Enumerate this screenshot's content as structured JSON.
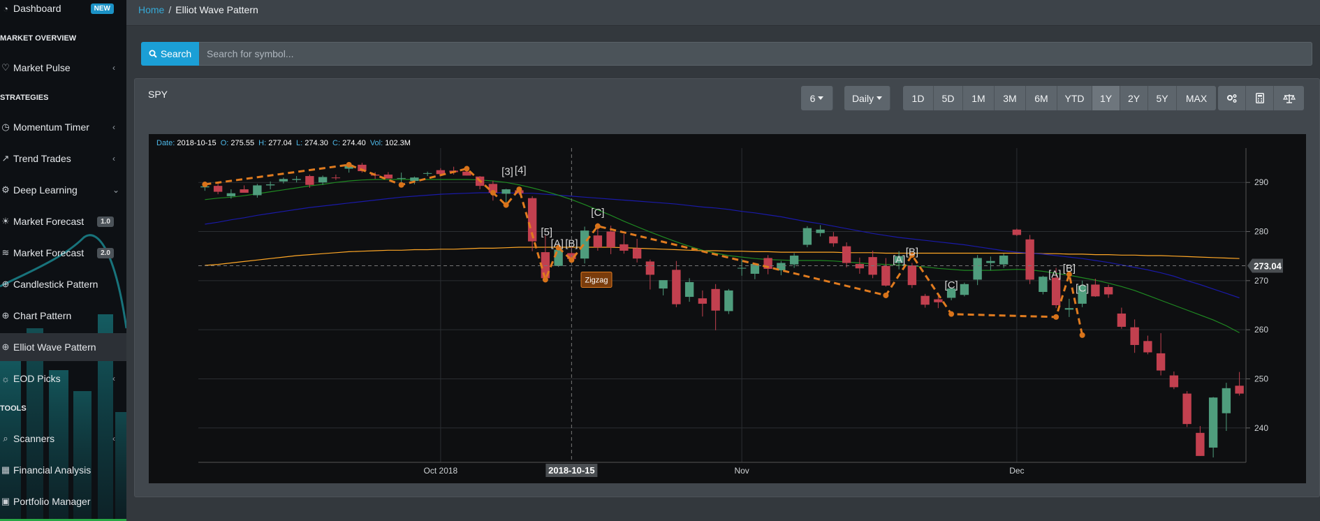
{
  "sidebar": {
    "items": [
      {
        "label": "Dashboard",
        "icon": "dashboard-icon",
        "badge": "NEW",
        "badge_type": "new"
      },
      {
        "section": "MARKET OVERVIEW"
      },
      {
        "label": "Market Pulse",
        "icon": "heart-icon",
        "chevron": "‹"
      },
      {
        "section": "STRATEGIES"
      },
      {
        "label": "Momentum Timer",
        "icon": "timer-icon",
        "chevron": "‹"
      },
      {
        "label": "Trend Trades",
        "icon": "line-chart-icon",
        "chevron": "‹"
      },
      {
        "label": "Deep Learning",
        "icon": "brain-icon",
        "chevron": "⌄"
      },
      {
        "label": "Market Forecast",
        "icon": "bulb-icon",
        "badge": "1.0",
        "badge_type": "ver"
      },
      {
        "label": "Market Forecast",
        "icon": "signal-icon",
        "badge": "2.0",
        "badge_type": "ver"
      },
      {
        "label": "Candlestick Pattern",
        "icon": "search-plus-icon"
      },
      {
        "label": "Chart Pattern",
        "icon": "search-plus-icon"
      },
      {
        "label": "Elliot Wave Pattern",
        "icon": "search-plus-icon",
        "active": true
      },
      {
        "label": "EOD Picks",
        "icon": "lightbulb-icon",
        "chevron": "‹"
      },
      {
        "section": "TOOLS"
      },
      {
        "label": "Scanners",
        "icon": "search-icon",
        "chevron": "‹"
      },
      {
        "label": "Financial Analysis",
        "icon": "grid-icon"
      },
      {
        "label": "Portfolio Manager",
        "icon": "briefcase-icon"
      }
    ]
  },
  "breadcrumb": {
    "home": "Home",
    "separator": "/",
    "current": "Elliot Wave Pattern"
  },
  "search": {
    "button_label": "Search",
    "placeholder": "Search for symbol..."
  },
  "panel": {
    "symbol": "SPY",
    "count_select": "6",
    "interval_select": "Daily",
    "ranges": [
      "1D",
      "5D",
      "1M",
      "3M",
      "6M",
      "YTD",
      "1Y",
      "2Y",
      "5Y",
      "MAX"
    ],
    "active_range": "1Y",
    "tool_icons": [
      "settings-icon",
      "calculator-icon",
      "balance-scale-icon"
    ]
  },
  "chart_data": {
    "type": "candlestick",
    "symbol": "SPY",
    "info": {
      "date_label": "Date:",
      "date": "2018-10-15",
      "o_label": "O:",
      "open": "275.55",
      "h_label": "H:",
      "high": "277.04",
      "l_label": "L:",
      "low": "274.30",
      "c_label": "C:",
      "close": "274.40",
      "vol_label": "Vol:",
      "volume": "102.3M"
    },
    "y_ticks": [
      290,
      280,
      270,
      260,
      250,
      240
    ],
    "y_range": [
      233,
      297
    ],
    "x_labels": [
      {
        "label": "Oct 2018",
        "i": 18
      },
      {
        "label": "Nov",
        "i": 41
      },
      {
        "label": "Dec",
        "i": 62
      }
    ],
    "crosshair": {
      "i": 28,
      "date_label": "2018-10-15",
      "price_label": "273.04",
      "price": 273.04
    },
    "candles": [
      {
        "o": 289.0,
        "h": 289.7,
        "l": 288.3,
        "c": 289.2
      },
      {
        "o": 289.3,
        "h": 289.8,
        "l": 287.6,
        "c": 288.1
      },
      {
        "o": 287.2,
        "h": 288.6,
        "l": 286.7,
        "c": 287.8
      },
      {
        "o": 288.6,
        "h": 289.4,
        "l": 287.9,
        "c": 287.9
      },
      {
        "o": 287.4,
        "h": 289.7,
        "l": 286.9,
        "c": 289.4
      },
      {
        "o": 289.4,
        "h": 290.2,
        "l": 288.6,
        "c": 289.6
      },
      {
        "o": 290.2,
        "h": 291.0,
        "l": 289.8,
        "c": 290.7
      },
      {
        "o": 290.5,
        "h": 291.3,
        "l": 290.0,
        "c": 290.7
      },
      {
        "o": 291.3,
        "h": 291.6,
        "l": 288.9,
        "c": 289.5
      },
      {
        "o": 290.0,
        "h": 291.4,
        "l": 289.5,
        "c": 291.1
      },
      {
        "o": 291.0,
        "h": 291.6,
        "l": 290.5,
        "c": 290.9
      },
      {
        "o": 292.8,
        "h": 293.8,
        "l": 292.0,
        "c": 293.6
      },
      {
        "o": 293.6,
        "h": 294.0,
        "l": 292.0,
        "c": 292.3
      },
      {
        "o": 291.6,
        "h": 292.1,
        "l": 290.7,
        "c": 291.4
      },
      {
        "o": 291.6,
        "h": 292.1,
        "l": 290.8,
        "c": 290.8
      },
      {
        "o": 290.8,
        "h": 292.0,
        "l": 290.0,
        "c": 290.9
      },
      {
        "o": 290.3,
        "h": 291.2,
        "l": 289.6,
        "c": 291.0
      },
      {
        "o": 291.8,
        "h": 292.2,
        "l": 291.3,
        "c": 291.9
      },
      {
        "o": 292.5,
        "h": 292.9,
        "l": 291.4,
        "c": 291.7
      },
      {
        "o": 292.4,
        "h": 293.2,
        "l": 291.6,
        "c": 292.1
      },
      {
        "o": 292.2,
        "h": 292.6,
        "l": 291.4,
        "c": 291.4
      },
      {
        "o": 291.2,
        "h": 291.3,
        "l": 288.6,
        "c": 289.3
      },
      {
        "o": 289.7,
        "h": 290.3,
        "l": 286.3,
        "c": 287.9
      },
      {
        "o": 287.7,
        "h": 288.7,
        "l": 285.4,
        "c": 288.6
      },
      {
        "o": 288.4,
        "h": 288.9,
        "l": 287.5,
        "c": 287.8
      },
      {
        "o": 286.8,
        "h": 287.2,
        "l": 276.0,
        "c": 278.0
      },
      {
        "o": 275.8,
        "h": 279.2,
        "l": 269.9,
        "c": 270.5
      },
      {
        "o": 273.0,
        "h": 276.5,
        "l": 272.8,
        "c": 276.3
      },
      {
        "o": 275.6,
        "h": 277.0,
        "l": 274.3,
        "c": 274.4
      },
      {
        "o": 274.5,
        "h": 281.0,
        "l": 273.5,
        "c": 280.2
      },
      {
        "o": 279.2,
        "h": 281.7,
        "l": 276.1,
        "c": 276.8
      },
      {
        "o": 280.0,
        "h": 281.2,
        "l": 275.4,
        "c": 276.8
      },
      {
        "o": 277.4,
        "h": 279.5,
        "l": 275.5,
        "c": 276.1
      },
      {
        "o": 276.6,
        "h": 278.5,
        "l": 273.7,
        "c": 274.5
      },
      {
        "o": 273.9,
        "h": 274.3,
        "l": 268.2,
        "c": 271.2
      },
      {
        "o": 268.4,
        "h": 270.0,
        "l": 267.0,
        "c": 270.1
      },
      {
        "o": 272.2,
        "h": 274.0,
        "l": 264.6,
        "c": 265.2
      },
      {
        "o": 266.7,
        "h": 270.5,
        "l": 265.7,
        "c": 269.7
      },
      {
        "o": 266.4,
        "h": 268.0,
        "l": 262.7,
        "c": 265.3
      },
      {
        "o": 268.3,
        "h": 269.3,
        "l": 259.9,
        "c": 263.9
      },
      {
        "o": 263.8,
        "h": 268.3,
        "l": 263.2,
        "c": 268.0
      },
      {
        "o": 272.6,
        "h": 274.4,
        "l": 271.0,
        "c": 272.6
      },
      {
        "o": 271.4,
        "h": 273.6,
        "l": 270.3,
        "c": 273.4
      },
      {
        "o": 274.6,
        "h": 275.2,
        "l": 271.3,
        "c": 272.4
      },
      {
        "o": 272.1,
        "h": 274.0,
        "l": 271.1,
        "c": 273.6
      },
      {
        "o": 273.3,
        "h": 275.6,
        "l": 272.6,
        "c": 275.1
      },
      {
        "o": 277.3,
        "h": 281.1,
        "l": 276.8,
        "c": 280.7
      },
      {
        "o": 279.7,
        "h": 281.3,
        "l": 279.0,
        "c": 280.4
      },
      {
        "o": 279.0,
        "h": 279.9,
        "l": 276.9,
        "c": 277.6
      },
      {
        "o": 277.0,
        "h": 277.8,
        "l": 272.7,
        "c": 273.6
      },
      {
        "o": 273.4,
        "h": 274.7,
        "l": 271.4,
        "c": 272.5
      },
      {
        "o": 274.8,
        "h": 276.1,
        "l": 270.5,
        "c": 271.2
      },
      {
        "o": 273.0,
        "h": 274.6,
        "l": 268.8,
        "c": 269.0
      },
      {
        "o": 273.6,
        "h": 276.0,
        "l": 272.3,
        "c": 275.0
      },
      {
        "o": 273.1,
        "h": 273.6,
        "l": 268.5,
        "c": 269.1
      },
      {
        "o": 266.9,
        "h": 267.3,
        "l": 264.5,
        "c": 265.1
      },
      {
        "o": 266.2,
        "h": 267.2,
        "l": 264.4,
        "c": 265.6
      },
      {
        "o": 266.5,
        "h": 268.6,
        "l": 266.0,
        "c": 268.4
      },
      {
        "o": 267.1,
        "h": 269.6,
        "l": 266.8,
        "c": 269.3
      },
      {
        "o": 270.2,
        "h": 275.2,
        "l": 269.1,
        "c": 274.6
      },
      {
        "o": 273.6,
        "h": 274.9,
        "l": 272.1,
        "c": 274.0
      },
      {
        "o": 273.3,
        "h": 275.5,
        "l": 272.6,
        "c": 275.1
      },
      {
        "o": 280.4,
        "h": 280.6,
        "l": 279.1,
        "c": 279.3
      },
      {
        "o": 278.4,
        "h": 279.3,
        "l": 269.3,
        "c": 270.2
      },
      {
        "o": 267.7,
        "h": 271.0,
        "l": 267.2,
        "c": 270.8
      },
      {
        "o": 270.6,
        "h": 272.6,
        "l": 264.4,
        "c": 265.0
      },
      {
        "o": 264.1,
        "h": 266.3,
        "l": 262.6,
        "c": 264.4
      },
      {
        "o": 265.3,
        "h": 270.0,
        "l": 264.6,
        "c": 269.0
      },
      {
        "o": 269.2,
        "h": 270.4,
        "l": 266.7,
        "c": 266.8
      },
      {
        "o": 268.7,
        "h": 269.2,
        "l": 266.5,
        "c": 267.2
      },
      {
        "o": 263.3,
        "h": 264.5,
        "l": 260.2,
        "c": 260.6
      },
      {
        "o": 260.5,
        "h": 262.1,
        "l": 255.3,
        "c": 256.9
      },
      {
        "o": 257.7,
        "h": 258.8,
        "l": 255.0,
        "c": 255.4
      },
      {
        "o": 255.2,
        "h": 259.3,
        "l": 250.7,
        "c": 251.7
      },
      {
        "o": 250.7,
        "h": 251.5,
        "l": 247.9,
        "c": 248.3
      },
      {
        "o": 247.0,
        "h": 247.5,
        "l": 240.2,
        "c": 240.8
      },
      {
        "o": 239.0,
        "h": 240.4,
        "l": 234.3,
        "c": 234.3
      },
      {
        "o": 236.0,
        "h": 246.3,
        "l": 234.0,
        "c": 246.2
      },
      {
        "o": 243.0,
        "h": 249.2,
        "l": 239.4,
        "c": 248.1
      },
      {
        "o": 248.6,
        "h": 251.4,
        "l": 246.6,
        "c": 247.0
      }
    ],
    "moving_averages": [
      {
        "color": "#ffa726",
        "values": [
          273.1,
          273.3,
          273.6,
          273.9,
          274.2,
          274.5,
          274.8,
          275.1,
          275.3,
          275.5,
          275.7,
          275.9,
          276.0,
          276.1,
          276.2,
          276.2,
          276.3,
          276.3,
          276.4,
          276.4,
          276.5,
          276.6,
          276.6,
          276.7,
          276.8,
          276.8,
          276.8,
          276.8,
          276.8,
          276.8,
          276.8,
          276.8,
          276.7,
          276.6,
          276.5,
          276.4,
          276.3,
          276.2,
          276.1,
          276.1,
          276.0,
          276.0,
          275.9,
          275.9,
          275.8,
          275.8,
          275.8,
          275.8,
          275.8,
          275.7,
          275.7,
          275.7,
          275.6,
          275.6,
          275.6,
          275.6,
          275.6,
          275.6,
          275.6,
          275.6,
          275.6,
          275.6,
          275.6,
          275.6,
          275.5,
          275.5,
          275.4,
          275.4,
          275.3,
          275.3,
          275.2,
          275.2,
          275.1,
          275.1,
          275.0,
          274.9,
          274.8,
          274.7,
          274.6,
          274.5
        ]
      },
      {
        "color": "#1a1aa8",
        "values": [
          281.5,
          281.9,
          282.4,
          282.8,
          283.3,
          283.7,
          284.1,
          284.5,
          284.9,
          285.2,
          285.5,
          285.8,
          286.1,
          286.4,
          286.7,
          287.0,
          287.2,
          287.4,
          287.6,
          287.7,
          287.8,
          287.9,
          287.9,
          287.9,
          287.8,
          287.8,
          287.6,
          287.4,
          287.2,
          287.0,
          286.8,
          286.6,
          286.4,
          286.2,
          286.0,
          285.8,
          285.6,
          285.3,
          285.0,
          284.8,
          284.5,
          284.1,
          283.8,
          283.4,
          283.0,
          282.5,
          282.0,
          281.6,
          281.1,
          280.6,
          280.1,
          279.6,
          279.2,
          278.8,
          278.5,
          278.2,
          277.9,
          277.6,
          277.3,
          276.9,
          276.5,
          276.1,
          275.8,
          275.6,
          275.4,
          275.1,
          274.8,
          274.5,
          274.1,
          273.7,
          273.2,
          272.7,
          272.2,
          271.6,
          270.9,
          270.0,
          269.2,
          268.3,
          267.4,
          266.5
        ]
      },
      {
        "color": "#1f8a22",
        "values": [
          286.5,
          286.8,
          287.0,
          287.3,
          287.7,
          288.1,
          288.5,
          288.9,
          289.3,
          289.6,
          290.0,
          290.3,
          290.5,
          290.6,
          290.6,
          290.6,
          290.6,
          290.6,
          290.6,
          290.6,
          290.6,
          290.5,
          290.3,
          290.0,
          289.5,
          288.9,
          288.2,
          287.4,
          286.5,
          285.5,
          284.4,
          283.3,
          282.1,
          281.0,
          279.9,
          278.9,
          277.9,
          277.0,
          276.2,
          275.6,
          275.1,
          274.8,
          274.5,
          274.3,
          274.2,
          274.1,
          274.1,
          274.1,
          274.0,
          273.8,
          273.6,
          273.4,
          273.3,
          273.2,
          273.0,
          272.8,
          272.5,
          272.3,
          272.1,
          272.1,
          272.1,
          272.2,
          272.3,
          272.2,
          271.9,
          271.5,
          271.1,
          270.6,
          270.1,
          269.5,
          268.8,
          268.0,
          267.0,
          266.0,
          265.0,
          264.0,
          263.0,
          262.0,
          260.8,
          259.4
        ]
      }
    ],
    "wave_points": [
      {
        "i": 0,
        "p": 289.6
      },
      {
        "i": 11,
        "p": 293.6
      },
      {
        "i": 15,
        "p": 289.5
      },
      {
        "i": 20,
        "p": 292.8
      },
      {
        "i": 22,
        "p": 287.9
      },
      {
        "i": 23,
        "p": 285.4
      },
      {
        "i": 24,
        "p": 288.6
      },
      {
        "i": 26,
        "p": 270.2
      },
      {
        "i": 27,
        "p": 276.7
      },
      {
        "i": 28,
        "p": 274.2
      },
      {
        "i": 30,
        "p": 281.1
      },
      {
        "i": 52,
        "p": 267.0
      },
      {
        "i": 54,
        "p": 275.2
      },
      {
        "i": 57,
        "p": 263.2
      },
      {
        "i": 65,
        "p": 262.6
      },
      {
        "i": 66,
        "p": 271.3
      },
      {
        "i": 67,
        "p": 258.9
      }
    ],
    "wave_labels": [
      {
        "text": "[3]",
        "i": 23.1,
        "p": 291.5
      },
      {
        "text": "[4]",
        "i": 24.1,
        "p": 291.8
      },
      {
        "text": "[5]",
        "i": 26.1,
        "p": 279.2
      },
      {
        "text": "[A]",
        "i": 26.9,
        "p": 276.9
      },
      {
        "text": "[B]",
        "i": 28.0,
        "p": 276.9
      },
      {
        "text": "[C]",
        "i": 30.0,
        "p": 283.2
      },
      {
        "text": "[A]",
        "i": 53.0,
        "p": 273.6
      },
      {
        "text": "[B]",
        "i": 54.0,
        "p": 275.2
      },
      {
        "text": "[C]",
        "i": 57.0,
        "p": 268.4
      },
      {
        "text": "[A]",
        "i": 64.9,
        "p": 270.6
      },
      {
        "text": "[B]",
        "i": 66.0,
        "p": 271.8
      },
      {
        "text": "[C]",
        "i": 67.0,
        "p": 267.8
      }
    ],
    "pattern_tag": {
      "text": "Zigzag",
      "i": 29.9,
      "p": 270.2
    }
  }
}
